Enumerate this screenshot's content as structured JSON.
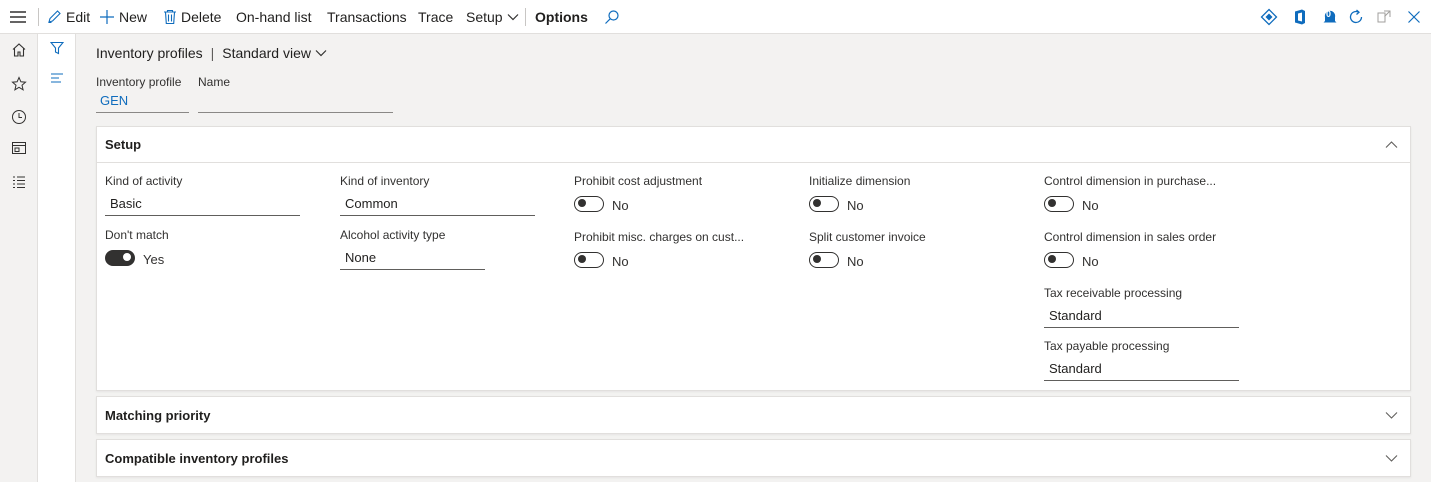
{
  "toolbar": {
    "edit": "Edit",
    "new": "New",
    "delete": "Delete",
    "onhand": "On-hand list",
    "transactions": "Transactions",
    "trace": "Trace",
    "setup": "Setup",
    "options": "Options",
    "notification_count": "0"
  },
  "breadcrumb": {
    "page": "Inventory profiles",
    "separator": "|",
    "view": "Standard view"
  },
  "header_fields": {
    "inventory_profile": {
      "label": "Inventory profile",
      "value": "GEN"
    },
    "name": {
      "label": "Name",
      "value": ""
    }
  },
  "setup": {
    "title": "Setup",
    "kind_of_activity": {
      "label": "Kind of activity",
      "value": "Basic"
    },
    "dont_match": {
      "label": "Don't match",
      "value": "Yes",
      "on": true
    },
    "kind_of_inventory": {
      "label": "Kind of inventory",
      "value": "Common"
    },
    "alcohol_activity_type": {
      "label": "Alcohol activity type",
      "value": "None"
    },
    "prohibit_cost_adjustment": {
      "label": "Prohibit cost adjustment",
      "value": "No",
      "on": false
    },
    "prohibit_misc_charges": {
      "label": "Prohibit misc. charges on cust...",
      "value": "No",
      "on": false
    },
    "initialize_dimension": {
      "label": "Initialize dimension",
      "value": "No",
      "on": false
    },
    "split_customer_invoice": {
      "label": "Split customer invoice",
      "value": "No",
      "on": false
    },
    "control_dim_purchase": {
      "label": "Control dimension in purchase...",
      "value": "No",
      "on": false
    },
    "control_dim_sales": {
      "label": "Control dimension in sales order",
      "value": "No",
      "on": false
    },
    "tax_receivable_processing": {
      "label": "Tax receivable processing",
      "value": "Standard"
    },
    "tax_payable_processing": {
      "label": "Tax payable processing",
      "value": "Standard"
    }
  },
  "fasttabs": {
    "matching_priority": "Matching priority",
    "compatible_profiles": "Compatible inventory profiles"
  },
  "colors": {
    "accent": "#0f6cbd",
    "toolbar_icon": "#0f6cbd"
  }
}
